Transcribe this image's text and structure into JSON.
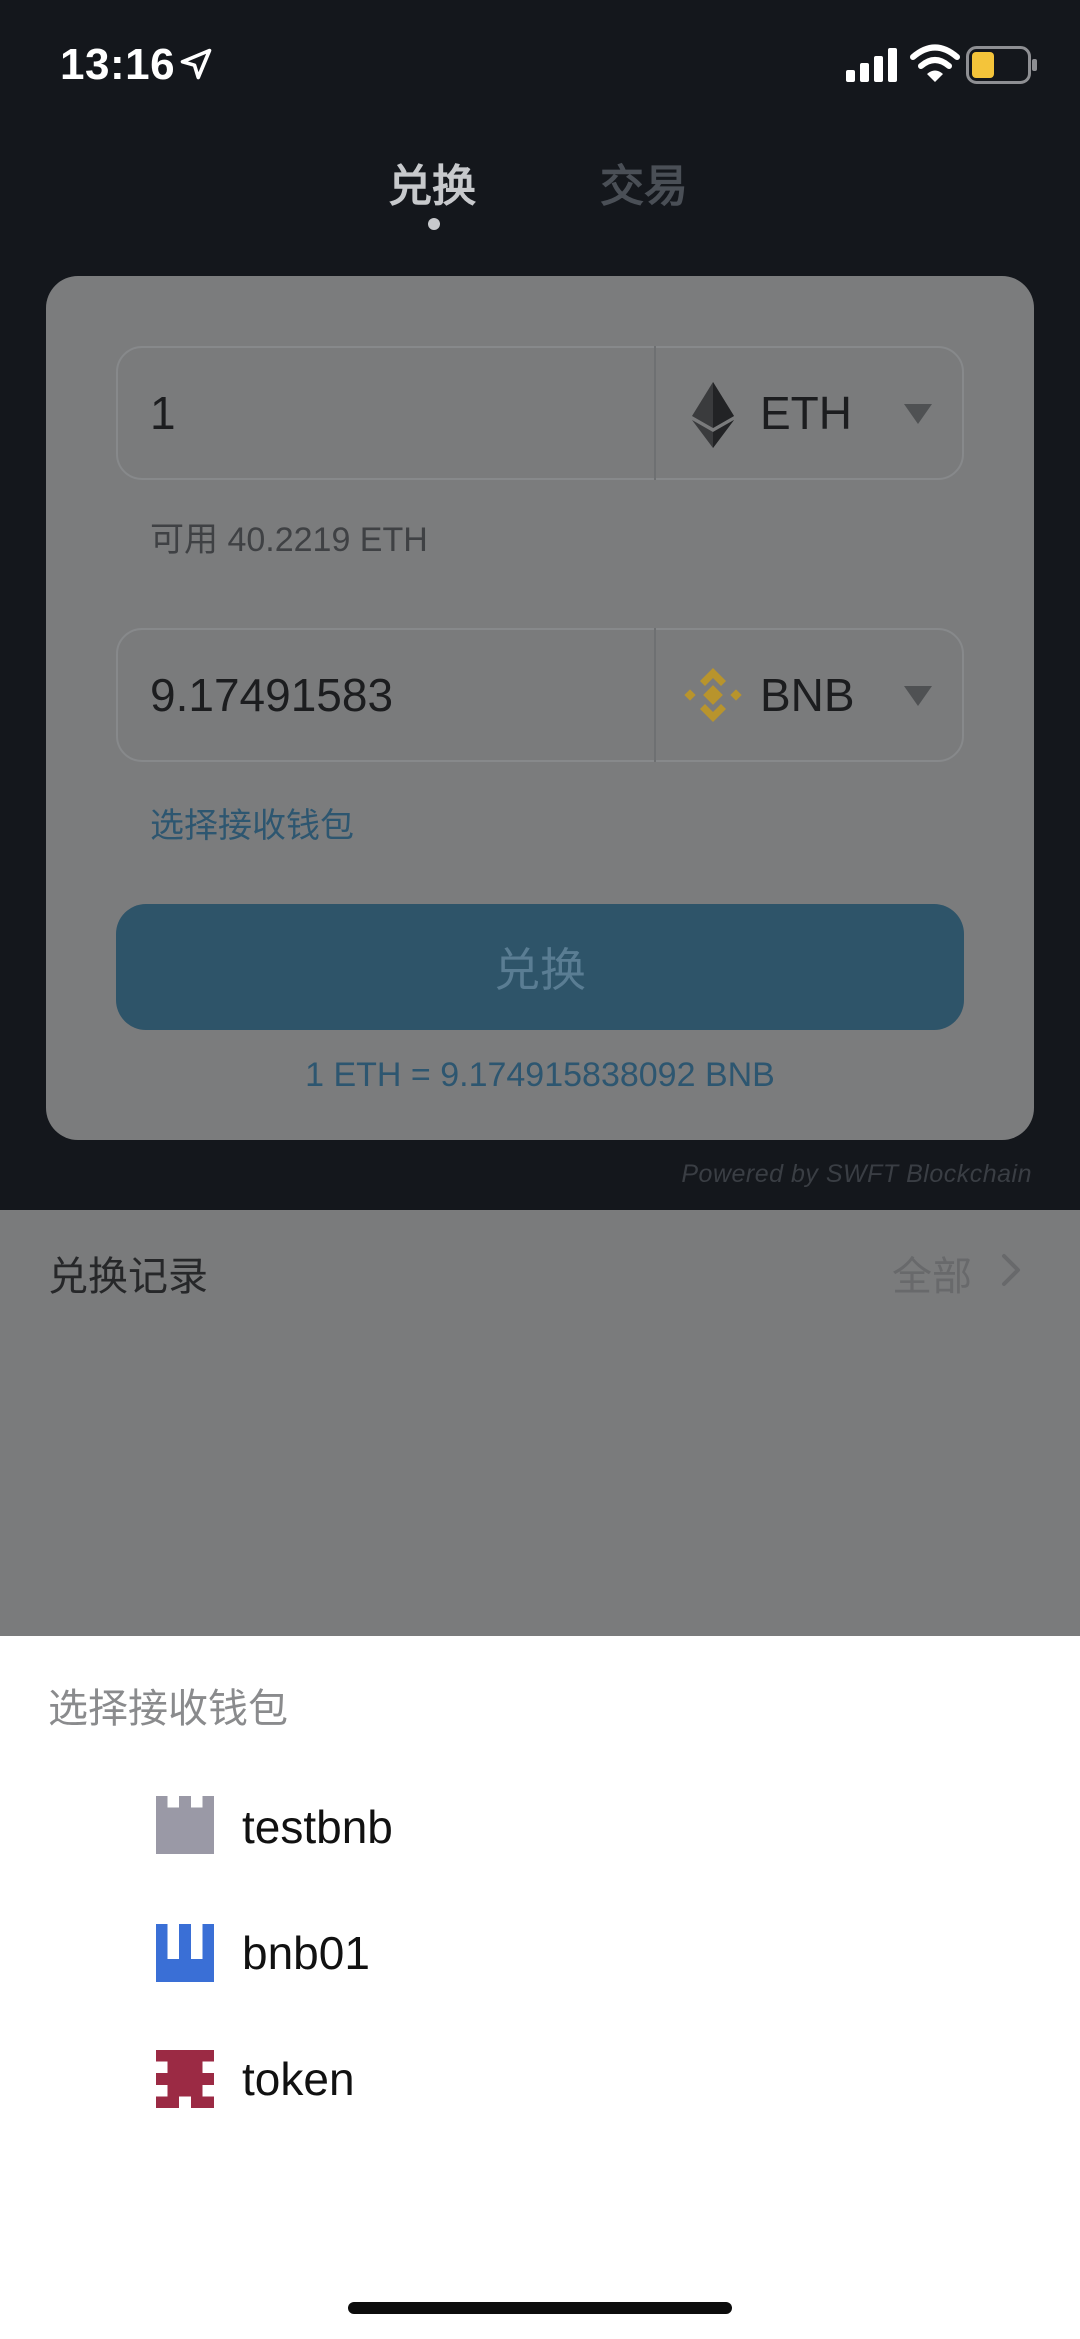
{
  "status_bar": {
    "time": "13:16"
  },
  "tabs": [
    {
      "label": "兑换",
      "active": true
    },
    {
      "label": "交易",
      "active": false
    }
  ],
  "swap": {
    "from_amount": "1",
    "from_coin": "ETH",
    "available": "可用 40.2219 ETH",
    "to_amount": "9.17491583",
    "to_coin": "BNB",
    "choose_wallet_link": "选择接收钱包",
    "button_label": "兑换",
    "rate": "1 ETH = 9.174915838092 BNB",
    "powered_by": "Powered by SWFT Blockchain"
  },
  "history": {
    "title": "兑换记录",
    "all_label": "全部"
  },
  "sheet": {
    "title": "选择接收钱包",
    "wallets": [
      {
        "name": "testbnb",
        "icon": "identicon-gray",
        "color": "#9a99a6"
      },
      {
        "name": "bnb01",
        "icon": "identicon-blue",
        "color": "#3a6fd6"
      },
      {
        "name": "token",
        "icon": "identicon-red",
        "color": "#9b2a44"
      }
    ]
  },
  "colors": {
    "accent": "#4fb3e6",
    "bnb": "#b8942c"
  }
}
